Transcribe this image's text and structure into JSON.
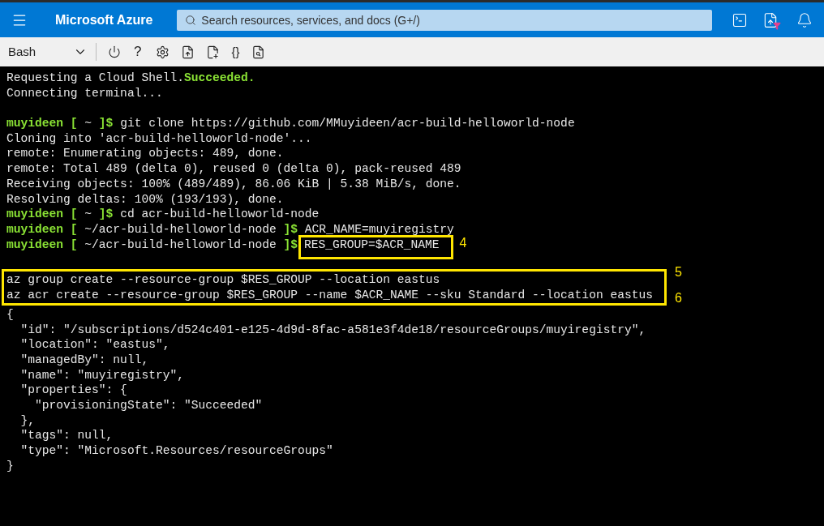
{
  "header": {
    "brand": "Microsoft Azure",
    "search": {
      "placeholder": "Search resources, services, and docs (G+/)"
    }
  },
  "toolbar": {
    "shell": "Bash",
    "help": "?",
    "braces": "{}"
  },
  "terminal": {
    "lines": [
      {
        "kind": "text",
        "parts": [
          {
            "kind": "plain",
            "text": "Requesting a Cloud Shell."
          },
          {
            "kind": "success",
            "text": "Succeeded."
          }
        ]
      },
      {
        "kind": "text",
        "parts": [
          {
            "kind": "plain",
            "text": "Connecting terminal..."
          }
        ]
      },
      {
        "kind": "blank"
      },
      {
        "kind": "text",
        "parts": [
          {
            "kind": "user",
            "text": "muyideen"
          },
          {
            "kind": "bracket",
            "text": " [ "
          },
          {
            "kind": "plain",
            "text": "~"
          },
          {
            "kind": "bracket",
            "text": " ]$"
          },
          {
            "kind": "plain",
            "text": " git clone https://github.com/MMuyideen/acr-build-helloworld-node"
          }
        ]
      },
      {
        "kind": "text",
        "parts": [
          {
            "kind": "plain",
            "text": "Cloning into 'acr-build-helloworld-node'..."
          }
        ]
      },
      {
        "kind": "text",
        "parts": [
          {
            "kind": "plain",
            "text": "remote: Enumerating objects: 489, done."
          }
        ]
      },
      {
        "kind": "text",
        "parts": [
          {
            "kind": "plain",
            "text": "remote: Total 489 (delta 0), reused 0 (delta 0), pack-reused 489"
          }
        ]
      },
      {
        "kind": "text",
        "parts": [
          {
            "kind": "plain",
            "text": "Receiving objects: 100% (489/489), 86.06 KiB | 5.38 MiB/s, done."
          }
        ]
      },
      {
        "kind": "text",
        "parts": [
          {
            "kind": "plain",
            "text": "Resolving deltas: 100% (193/193), done."
          }
        ]
      },
      {
        "kind": "text",
        "parts": [
          {
            "kind": "user",
            "text": "muyideen"
          },
          {
            "kind": "bracket",
            "text": " [ "
          },
          {
            "kind": "plain",
            "text": "~"
          },
          {
            "kind": "bracket",
            "text": " ]$"
          },
          {
            "kind": "plain",
            "text": " cd acr-build-helloworld-node"
          }
        ]
      },
      {
        "kind": "text",
        "parts": [
          {
            "kind": "user",
            "text": "muyideen"
          },
          {
            "kind": "bracket",
            "text": " [ "
          },
          {
            "kind": "plain",
            "text": "~/acr-build-helloworld-node"
          },
          {
            "kind": "bracket",
            "text": " ]$"
          },
          {
            "kind": "plain",
            "text": " ACR_NAME=muyiregistry"
          }
        ]
      },
      {
        "kind": "text",
        "parts": [
          {
            "kind": "user",
            "text": "muyideen"
          },
          {
            "kind": "bracket",
            "text": " [ "
          },
          {
            "kind": "plain",
            "text": "~/acr-build-helloworld-node"
          },
          {
            "kind": "bracket",
            "text": " ]$"
          },
          {
            "kind": "boxed",
            "text": "RES_GROUP=$ACR_NAME",
            "label": "4"
          }
        ]
      },
      {
        "kind": "blank"
      },
      {
        "kind": "boxed_group",
        "lines": [
          {
            "text": "az group create --resource-group $RES_GROUP --location eastus",
            "label": "5"
          },
          {
            "text": "az acr create --resource-group $RES_GROUP --name $ACR_NAME --sku Standard --location eastus",
            "label": "6"
          }
        ]
      },
      {
        "kind": "text",
        "parts": [
          {
            "kind": "plain",
            "text": "{"
          }
        ]
      },
      {
        "kind": "text",
        "parts": [
          {
            "kind": "plain",
            "text": "  \"id\": \"/subscriptions/d524c401-e125-4d9d-8fac-a581e3f4de18/resourceGroups/muyiregistry\","
          }
        ]
      },
      {
        "kind": "text",
        "parts": [
          {
            "kind": "plain",
            "text": "  \"location\": \"eastus\","
          }
        ]
      },
      {
        "kind": "text",
        "parts": [
          {
            "kind": "plain",
            "text": "  \"managedBy\": null,"
          }
        ]
      },
      {
        "kind": "text",
        "parts": [
          {
            "kind": "plain",
            "text": "  \"name\": \"muyiregistry\","
          }
        ]
      },
      {
        "kind": "text",
        "parts": [
          {
            "kind": "plain",
            "text": "  \"properties\": {"
          }
        ]
      },
      {
        "kind": "text",
        "parts": [
          {
            "kind": "plain",
            "text": "    \"provisioningState\": \"Succeeded\""
          }
        ]
      },
      {
        "kind": "text",
        "parts": [
          {
            "kind": "plain",
            "text": "  },"
          }
        ]
      },
      {
        "kind": "text",
        "parts": [
          {
            "kind": "plain",
            "text": "  \"tags\": null,"
          }
        ]
      },
      {
        "kind": "text",
        "parts": [
          {
            "kind": "plain",
            "text": "  \"type\": \"Microsoft.Resources/resourceGroups\""
          }
        ]
      },
      {
        "kind": "text",
        "parts": [
          {
            "kind": "plain",
            "text": "}"
          }
        ]
      }
    ]
  }
}
